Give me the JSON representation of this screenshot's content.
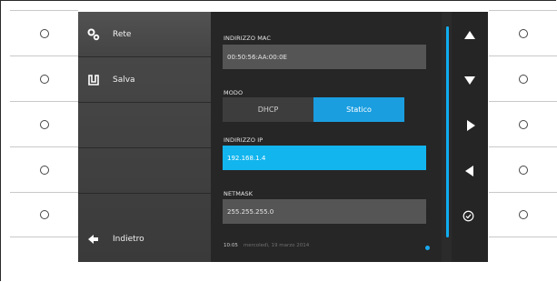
{
  "menu": {
    "items": [
      {
        "label": "Rete",
        "icon": "gears-icon"
      },
      {
        "label": "Salva",
        "icon": "save-icon"
      },
      {
        "label": ""
      },
      {
        "label": ""
      },
      {
        "label": "Indietro",
        "icon": "back-arrow-icon"
      }
    ]
  },
  "fields": {
    "mac": {
      "label": "INDIRIZZO MAC",
      "value": "00:50:56:AA:00:0E"
    },
    "mode": {
      "label": "MODO",
      "options": [
        "DHCP",
        "Statico"
      ],
      "selected": "Statico"
    },
    "ip": {
      "label": "INDIRIZZO IP",
      "value": "192.168.1.4"
    },
    "netmask": {
      "label": "NETMASK",
      "value": "255.255.255.0"
    }
  },
  "status": {
    "time": "10:05",
    "date": "mercoledì, 19 marzo 2014"
  },
  "colors": {
    "accent": "#12b5ee",
    "segment_selected": "#1a9ee0",
    "field_bg": "#555555"
  },
  "nav": {
    "buttons": [
      "arrow-up-icon",
      "arrow-down-icon",
      "arrow-right-icon",
      "arrow-left-icon",
      "confirm-check-icon"
    ]
  }
}
